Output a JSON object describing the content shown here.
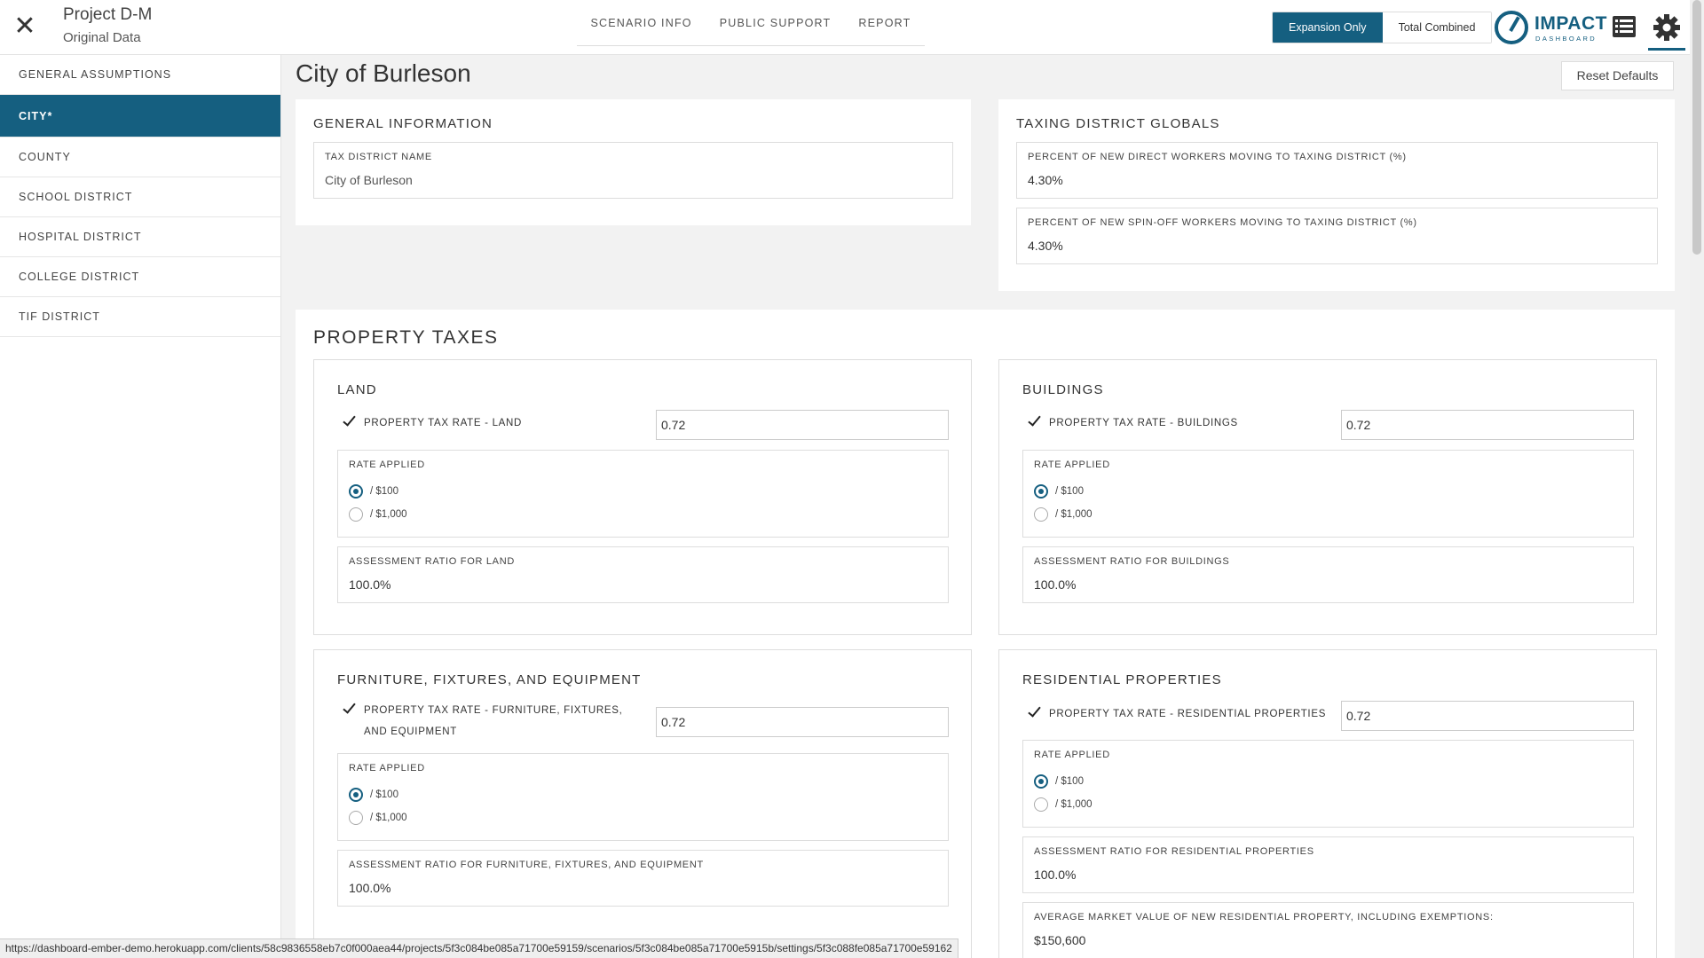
{
  "header": {
    "project_title": "Project D-M",
    "project_subtitle": "Original Data",
    "nav": [
      "SCENARIO INFO",
      "PUBLIC SUPPORT",
      "REPORT"
    ],
    "toggle": {
      "expansion_only": "Expansion Only",
      "total_combined": "Total Combined"
    },
    "logo": {
      "word": "IMPACT",
      "sub": "DASHBOARD"
    },
    "accent_color": "#155f80"
  },
  "sidebar": {
    "items": [
      "GENERAL ASSUMPTIONS",
      "CITY*",
      "COUNTY",
      "SCHOOL DISTRICT",
      "HOSPITAL DISTRICT",
      "COLLEGE DISTRICT",
      "TIF DISTRICT"
    ],
    "active": "CITY*"
  },
  "main": {
    "title": "City of Burleson",
    "reset_label": "Reset Defaults",
    "general_info": {
      "heading": "GENERAL INFORMATION",
      "tax_district_label": "TAX DISTRICT NAME",
      "tax_district_value": "City of Burleson"
    },
    "globals": {
      "heading": "TAXING DISTRICT GLOBALS",
      "direct_label": "PERCENT OF NEW DIRECT WORKERS MOVING TO TAXING DISTRICT (%)",
      "direct_value": "4.30%",
      "spinoff_label": "PERCENT OF NEW SPIN-OFF WORKERS MOVING TO TAXING DISTRICT (%)",
      "spinoff_value": "4.30%"
    },
    "property_taxes": {
      "heading": "PROPERTY TAXES",
      "rate_applied_label": "RATE APPLIED",
      "opt_100": "/ $100",
      "opt_1000": "/ $1,000",
      "land": {
        "heading": "LAND",
        "rate_label": "PROPERTY TAX RATE - LAND",
        "rate_value": "0.72",
        "assess_label": "ASSESSMENT RATIO FOR LAND",
        "assess_value": "100.0%"
      },
      "buildings": {
        "heading": "BUILDINGS",
        "rate_label": "PROPERTY TAX RATE - BUILDINGS",
        "rate_value": "0.72",
        "assess_label": "ASSESSMENT RATIO FOR BUILDINGS",
        "assess_value": "100.0%"
      },
      "ffe": {
        "heading": "FURNITURE, FIXTURES, AND EQUIPMENT",
        "rate_label_1": "PROPERTY TAX RATE - FURNITURE, FIXTURES,",
        "rate_label_2": "AND EQUIPMENT",
        "rate_value": "0.72",
        "assess_label": "ASSESSMENT RATIO FOR FURNITURE, FIXTURES, AND EQUIPMENT",
        "assess_value": "100.0%"
      },
      "residential": {
        "heading": "RESIDENTIAL PROPERTIES",
        "rate_label": "PROPERTY TAX RATE - RESIDENTIAL PROPERTIES",
        "rate_value": "0.72",
        "assess_label": "ASSESSMENT RATIO FOR RESIDENTIAL PROPERTIES",
        "assess_value": "100.0%",
        "market_label": "AVERAGE MARKET VALUE OF NEW RESIDENTIAL PROPERTY, INCLUDING EXEMPTIONS:",
        "market_value": "$150,600"
      }
    }
  },
  "status_url": "https://dashboard-ember-demo.herokuapp.com/clients/58c9836558eb7c0f000aea44/projects/5f3c084be085a71700e59159/scenarios/5f3c084be085a71700e5915b/settings/5f3c088fe085a71700e59162"
}
